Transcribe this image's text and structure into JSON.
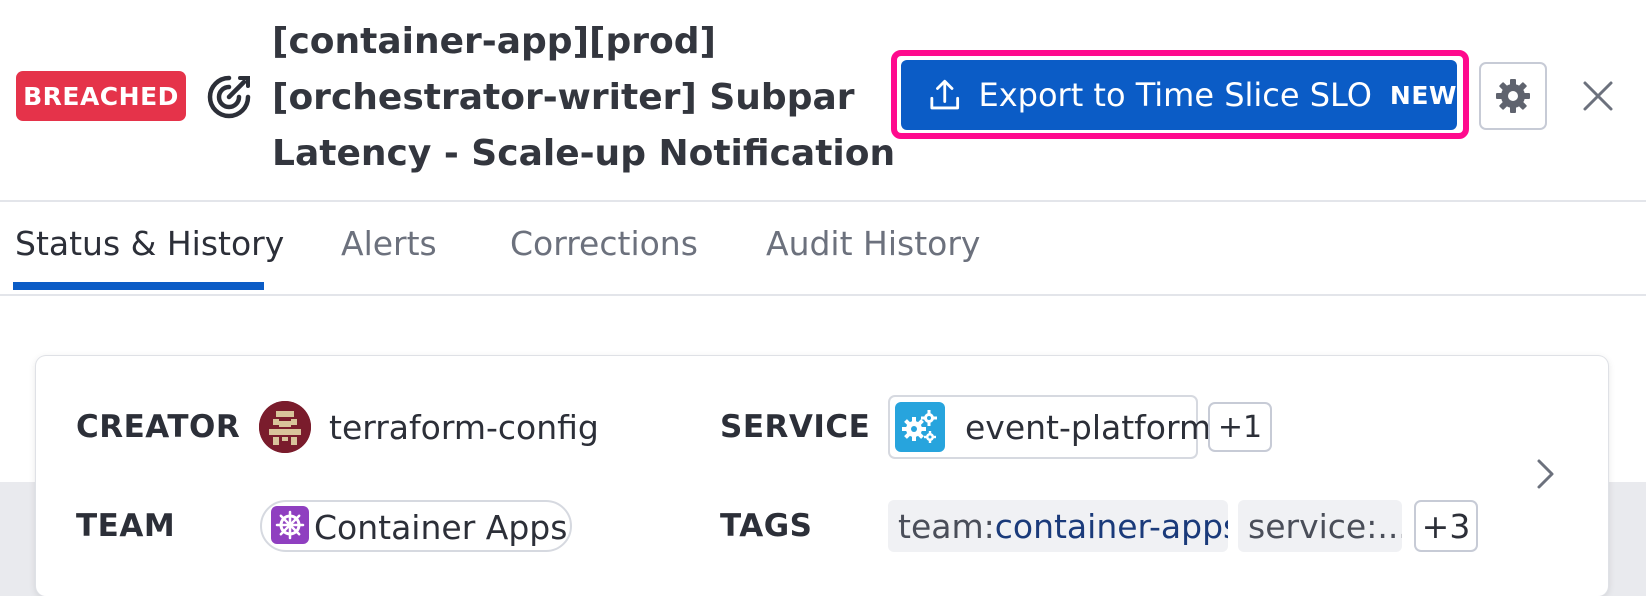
{
  "header": {
    "status_badge": "BREACHED",
    "title_lines": [
      "[container-app][prod]",
      "[orchestrator-writer] Subpar",
      "Latency - Scale-up Notification"
    ],
    "export_button": {
      "label": "Export to Time Slice SLO",
      "badge": "NEW"
    },
    "icons": {
      "slo": "slo-target-icon",
      "export": "upload-icon",
      "settings": "gear-icon",
      "close": "close-icon"
    }
  },
  "tabs": [
    {
      "label": "Status & History",
      "active": true
    },
    {
      "label": "Alerts",
      "active": false
    },
    {
      "label": "Corrections",
      "active": false
    },
    {
      "label": "Audit History",
      "active": false
    }
  ],
  "details": {
    "creator": {
      "label": "CREATOR",
      "value": "terraform-config"
    },
    "service": {
      "label": "SERVICE",
      "value": "event-platform",
      "more": "+1"
    },
    "team": {
      "label": "TEAM",
      "value": "Container Apps"
    },
    "tags": {
      "label": "TAGS",
      "items": [
        {
          "key": "team:",
          "value": "container-apps"
        },
        {
          "key": "service:...",
          "value": ""
        }
      ],
      "more": "+3"
    }
  },
  "colors": {
    "breached": "#e5334a",
    "primary": "#0b5cc6",
    "highlight": "#ff0a8d",
    "service_icon": "#27a4dd",
    "team_icon": "#8f3fc0"
  }
}
